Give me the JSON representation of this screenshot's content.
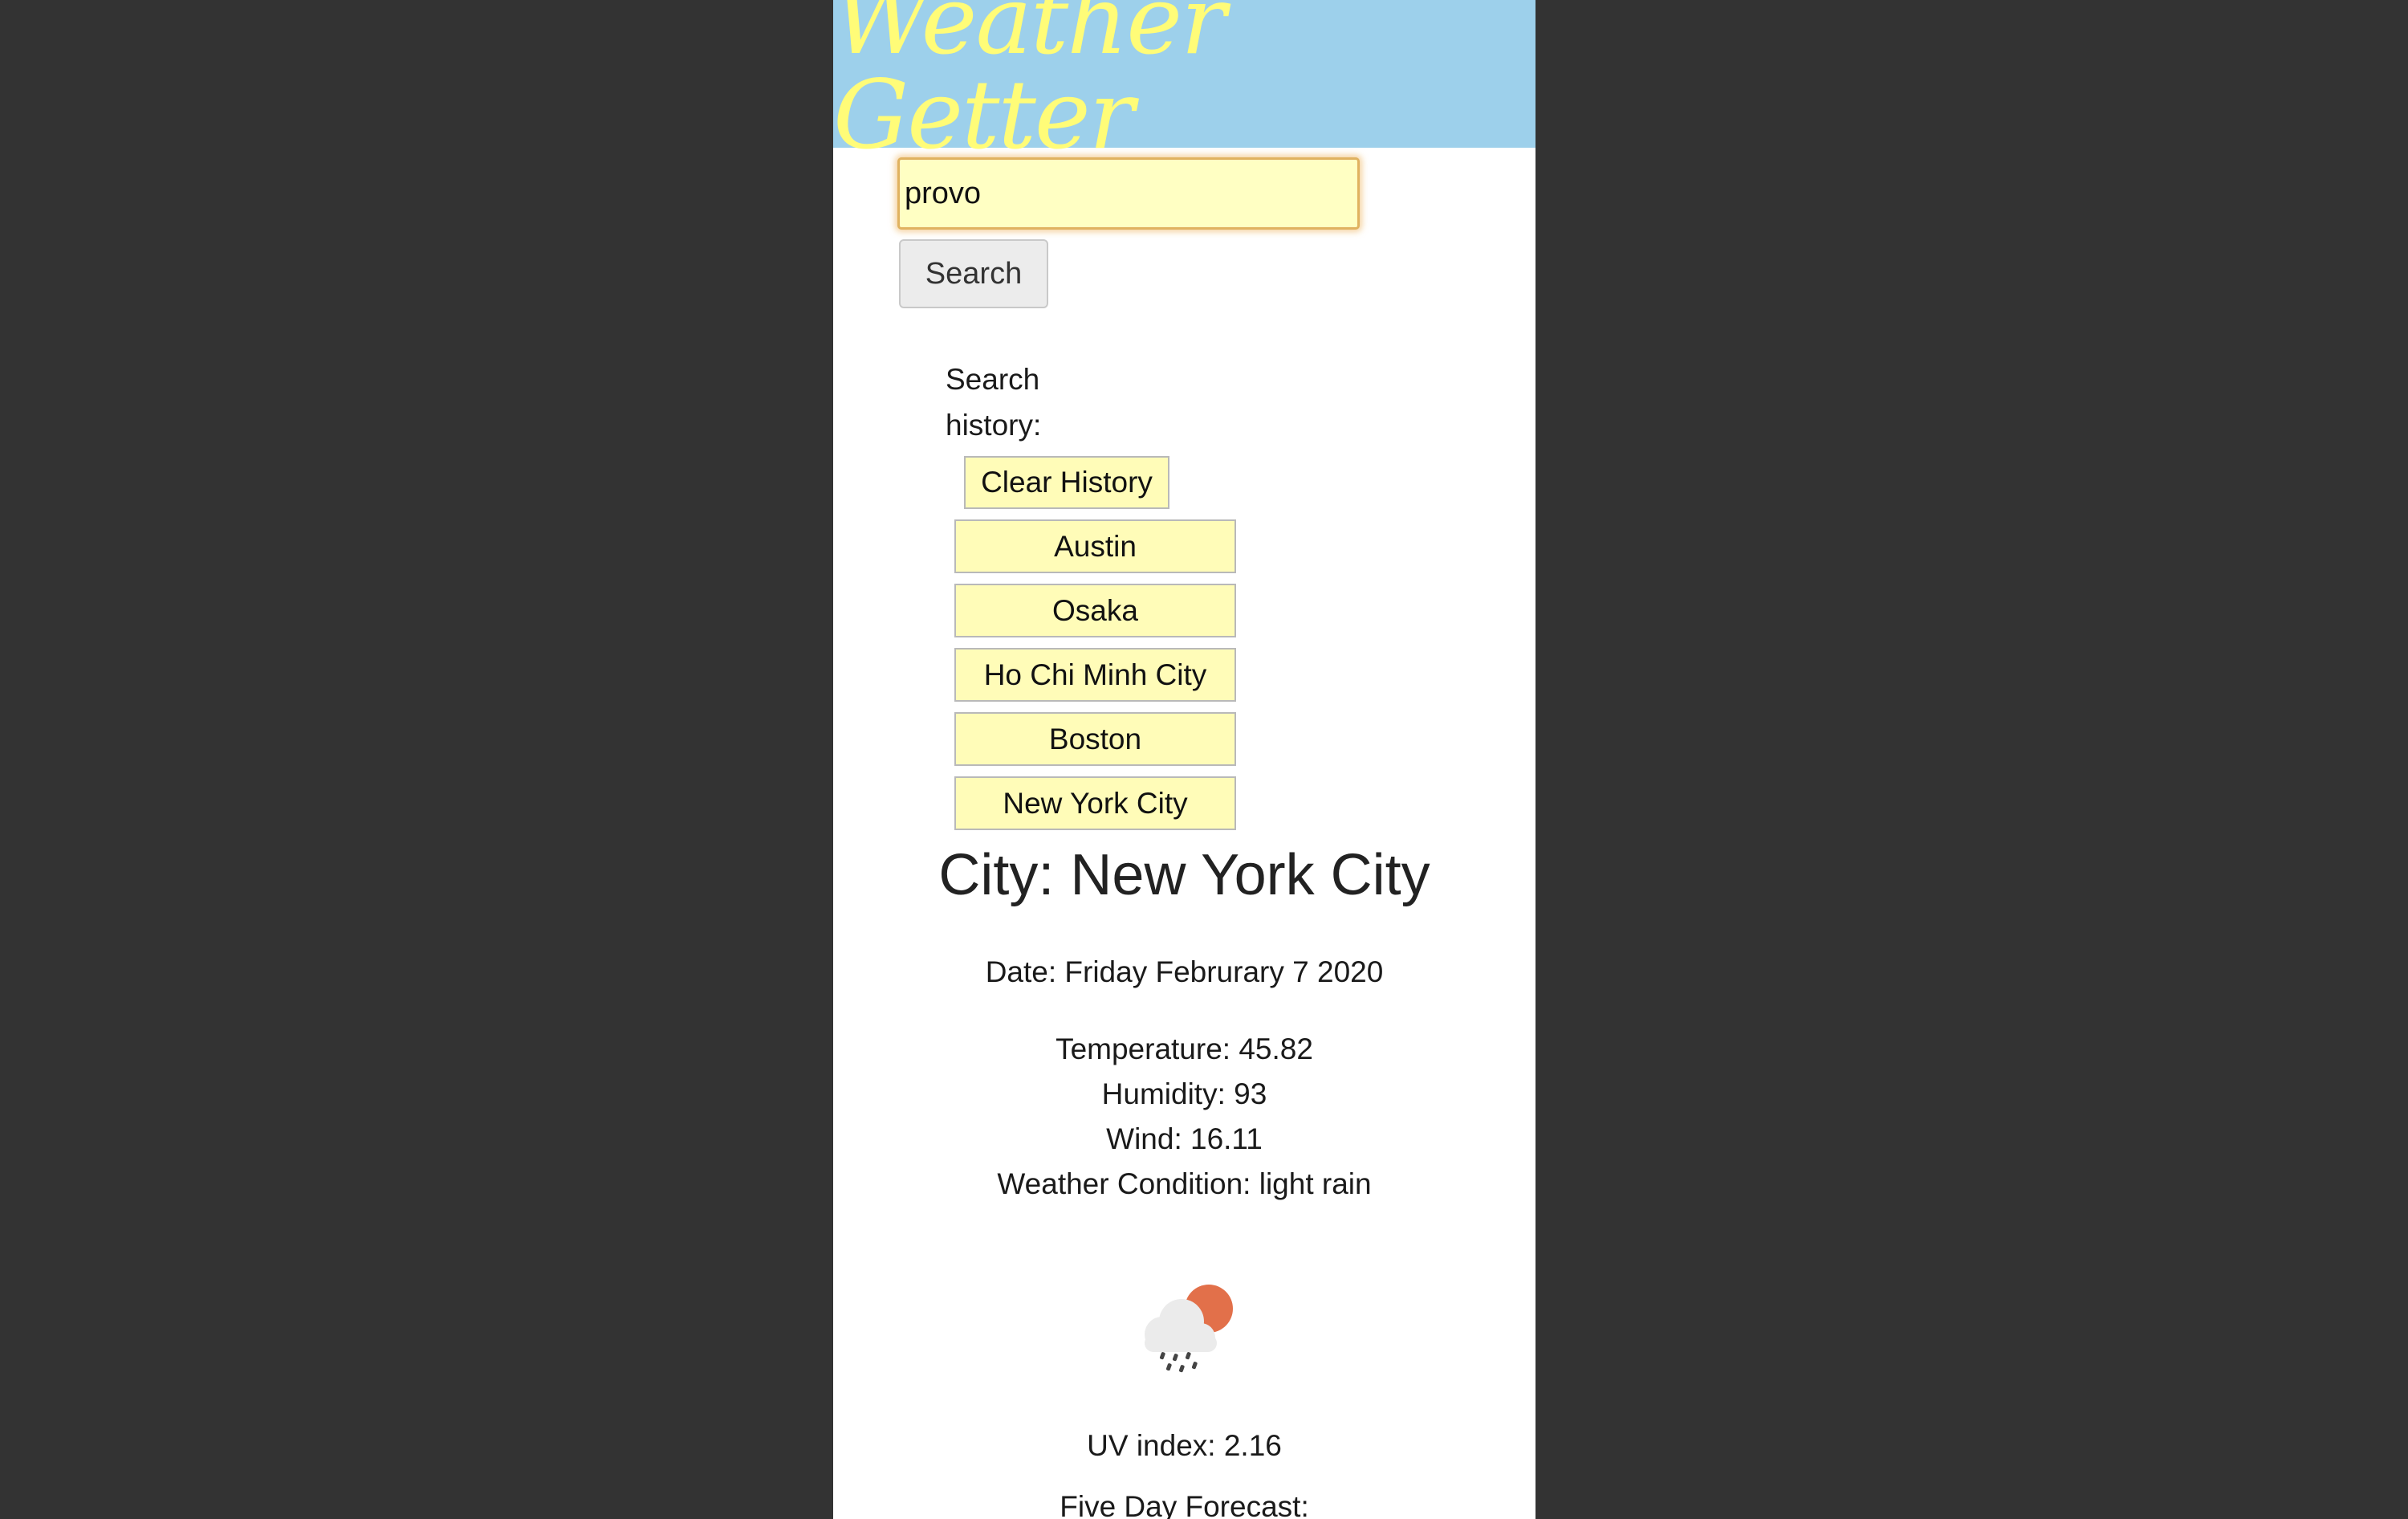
{
  "app": {
    "title": "Weather Getter",
    "colors": {
      "header_bg": "#9dd0eb",
      "title_text": "#fffc78",
      "button_bg": "#fffcb8",
      "outside_bg": "#333333"
    }
  },
  "search": {
    "value": "provo",
    "button_label": "Search"
  },
  "history": {
    "label": "Search history:",
    "clear_label": "Clear History",
    "items": [
      "Austin",
      "Osaka",
      "Ho Chi Minh City",
      "Boston",
      "New York City"
    ]
  },
  "weather": {
    "city": "City: New York City",
    "date": "Date: Friday Februrary 7 2020",
    "temperature": "Temperature: 45.82",
    "humidity": "Humidity: 93",
    "wind": "Wind: 16.11",
    "condition": "Weather Condition: light rain",
    "icon": "light-rain-sun-icon",
    "uv_index": "UV index: 2.16",
    "forecast_label": "Five Day Forecast:"
  }
}
